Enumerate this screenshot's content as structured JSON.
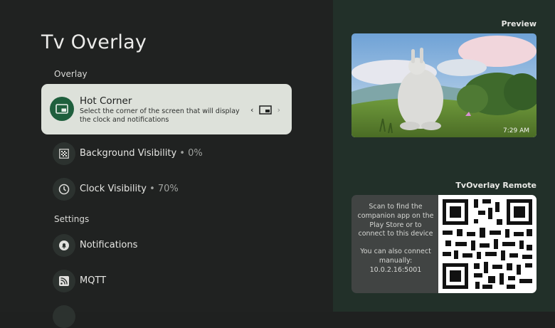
{
  "page": {
    "title": "Tv Overlay"
  },
  "overlay_section": {
    "label": "Overlay",
    "hot_corner": {
      "title": "Hot Corner",
      "description": "Select the corner of the screen that will display the clock and notifications",
      "left_arrow": "‹",
      "right_arrow": "›",
      "icon": "picture-in-picture-icon"
    },
    "items": [
      {
        "label": "Background Visibility",
        "value": " • 0%",
        "icon": "grid-pattern-icon"
      },
      {
        "label": "Clock Visibility",
        "value": " • 70%",
        "icon": "clock-icon"
      }
    ]
  },
  "settings_section": {
    "label": "Settings",
    "items": [
      {
        "label": "Notifications",
        "icon": "bell-icon"
      },
      {
        "label": "MQTT",
        "icon": "rss-feed-icon"
      }
    ]
  },
  "preview": {
    "label": "Preview",
    "time": "7:29 AM"
  },
  "remote": {
    "label": "TvOverlay Remote",
    "scan_text": "Scan to find the companion app on the Play Store or to connect to this device",
    "manual_text": "You can also connect manually:",
    "address": "10.0.2.16:5001"
  },
  "colors": {
    "accent": "#1f5f3d",
    "selected_card": "#dde1da",
    "right_panel": "#223029"
  }
}
